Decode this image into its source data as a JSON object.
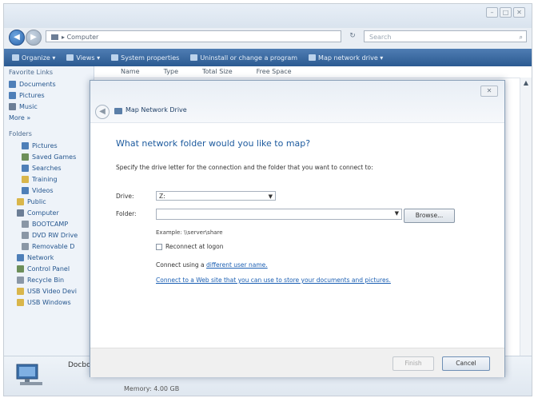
{
  "window": {
    "controls": [
      "–",
      "□",
      "✕"
    ],
    "address": "Computer",
    "address_sep": "▸",
    "search_placeholder": "Search",
    "nav": {
      "back": "◀",
      "forward": "▶",
      "refresh": "↻"
    }
  },
  "toolbar": {
    "items": [
      "Organize ▾",
      "Views ▾",
      "System properties",
      "Uninstall or change a program",
      "Map network drive ▾"
    ]
  },
  "sidebar": {
    "favorites_title": "Favorite Links",
    "favorites": [
      "Documents",
      "Pictures",
      "Music",
      "More »"
    ],
    "folders_title": "Folders",
    "folders": [
      {
        "label": "Pictures",
        "level": 1,
        "color": "#4e7fb8"
      },
      {
        "label": "Saved Games",
        "level": 1,
        "color": "#6d8f5a"
      },
      {
        "label": "Searches",
        "level": 1,
        "color": "#4e7fb8"
      },
      {
        "label": "Training",
        "level": 1,
        "color": "#d9b64b"
      },
      {
        "label": "Videos",
        "level": 1,
        "color": "#4e7fb8"
      },
      {
        "label": "Public",
        "level": 0,
        "color": "#d9b64b"
      },
      {
        "label": "Computer",
        "level": 0,
        "color": "#6c7e96"
      },
      {
        "label": "BOOTCAMP",
        "level": 1,
        "color": "#8a97a6"
      },
      {
        "label": "DVD RW Drive",
        "level": 1,
        "color": "#8a97a6"
      },
      {
        "label": "Removable D",
        "level": 1,
        "color": "#8a97a6"
      },
      {
        "label": "Network",
        "level": 0,
        "color": "#4e7fb8"
      },
      {
        "label": "Control Panel",
        "level": 0,
        "color": "#6d8f5a"
      },
      {
        "label": "Recycle Bin",
        "level": 0,
        "color": "#8a97a6"
      },
      {
        "label": "USB Video Devi",
        "level": 0,
        "color": "#d9b64b"
      },
      {
        "label": "USB Windows",
        "level": 0,
        "color": "#d9b64b"
      }
    ]
  },
  "columns": [
    "Name",
    "Type",
    "Total Size",
    "Free Space"
  ],
  "status": {
    "name": "Docbook",
    "sub": "Memory: 4.00 GB"
  },
  "dialog": {
    "title": "Map Network Drive",
    "heading": "What network folder would you like to map?",
    "description": "Specify the drive letter for the connection and the folder that you want to connect to:",
    "drive_label": "Drive:",
    "drive_value": "Z:",
    "folder_label": "Folder:",
    "folder_value": "",
    "browse_label": "Browse...",
    "example": "Example: \\\\server\\share",
    "reconnect_label": "Reconnect at logon",
    "reconnect_checked": false,
    "connect_prefix": "Connect using a ",
    "connect_link": "different user name.",
    "storage_link": "Connect to a Web site that you can use to store your documents and pictures.",
    "finish_label": "Finish",
    "cancel_label": "Cancel",
    "close": "✕"
  }
}
